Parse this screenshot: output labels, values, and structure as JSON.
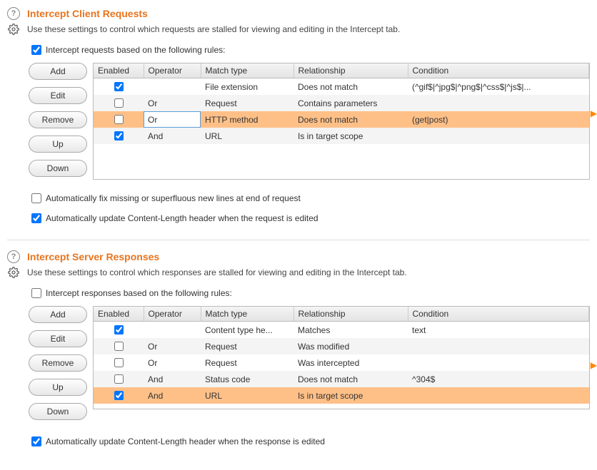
{
  "requests": {
    "title": "Intercept Client Requests",
    "desc": "Use these settings to control which requests are stalled for viewing and editing in the Intercept tab.",
    "main_checkbox_label": "Intercept requests based on the following rules:",
    "main_checkbox_checked": true,
    "buttons": {
      "add": "Add",
      "edit": "Edit",
      "remove": "Remove",
      "up": "Up",
      "down": "Down"
    },
    "columns": {
      "enabled": "Enabled",
      "operator": "Operator",
      "matchtype": "Match type",
      "relationship": "Relationship",
      "condition": "Condition"
    },
    "rows": [
      {
        "enabled": true,
        "operator": "",
        "matchtype": "File extension",
        "relationship": "Does not match",
        "condition": "(^gif$|^jpg$|^png$|^css$|^js$|...",
        "selected": false,
        "editing": false
      },
      {
        "enabled": false,
        "operator": "Or",
        "matchtype": "Request",
        "relationship": "Contains parameters",
        "condition": "",
        "selected": false,
        "editing": false
      },
      {
        "enabled": false,
        "operator": "Or",
        "matchtype": "HTTP method",
        "relationship": "Does not match",
        "condition": "(get|post)",
        "selected": true,
        "editing": true
      },
      {
        "enabled": true,
        "operator": "And",
        "matchtype": "URL",
        "relationship": "Is in target scope",
        "condition": "",
        "selected": false,
        "editing": false
      }
    ],
    "selected_index": 2,
    "opt1": {
      "label": "Automatically fix missing or superfluous new lines at end of request",
      "checked": false
    },
    "opt2": {
      "label": "Automatically update Content-Length header when the request is edited",
      "checked": true
    }
  },
  "responses": {
    "title": "Intercept Server Responses",
    "desc": "Use these settings to control which responses are stalled for viewing and editing in the Intercept tab.",
    "main_checkbox_label": "Intercept responses based on the following rules:",
    "main_checkbox_checked": false,
    "buttons": {
      "add": "Add",
      "edit": "Edit",
      "remove": "Remove",
      "up": "Up",
      "down": "Down"
    },
    "columns": {
      "enabled": "Enabled",
      "operator": "Operator",
      "matchtype": "Match type",
      "relationship": "Relationship",
      "condition": "Condition"
    },
    "rows": [
      {
        "enabled": true,
        "operator": "",
        "matchtype": "Content type he...",
        "relationship": "Matches",
        "condition": "text",
        "selected": false
      },
      {
        "enabled": false,
        "operator": "Or",
        "matchtype": "Request",
        "relationship": "Was modified",
        "condition": "",
        "selected": false
      },
      {
        "enabled": false,
        "operator": "Or",
        "matchtype": "Request",
        "relationship": "Was intercepted",
        "condition": "",
        "selected": false
      },
      {
        "enabled": false,
        "operator": "And",
        "matchtype": "Status code",
        "relationship": "Does not match",
        "condition": "^304$",
        "selected": false
      },
      {
        "enabled": true,
        "operator": "And",
        "matchtype": "URL",
        "relationship": "Is in target scope",
        "condition": "",
        "selected": true
      }
    ],
    "selected_index": 4,
    "opt1": {
      "label": "Automatically update Content-Length header when the response is edited",
      "checked": true
    }
  }
}
